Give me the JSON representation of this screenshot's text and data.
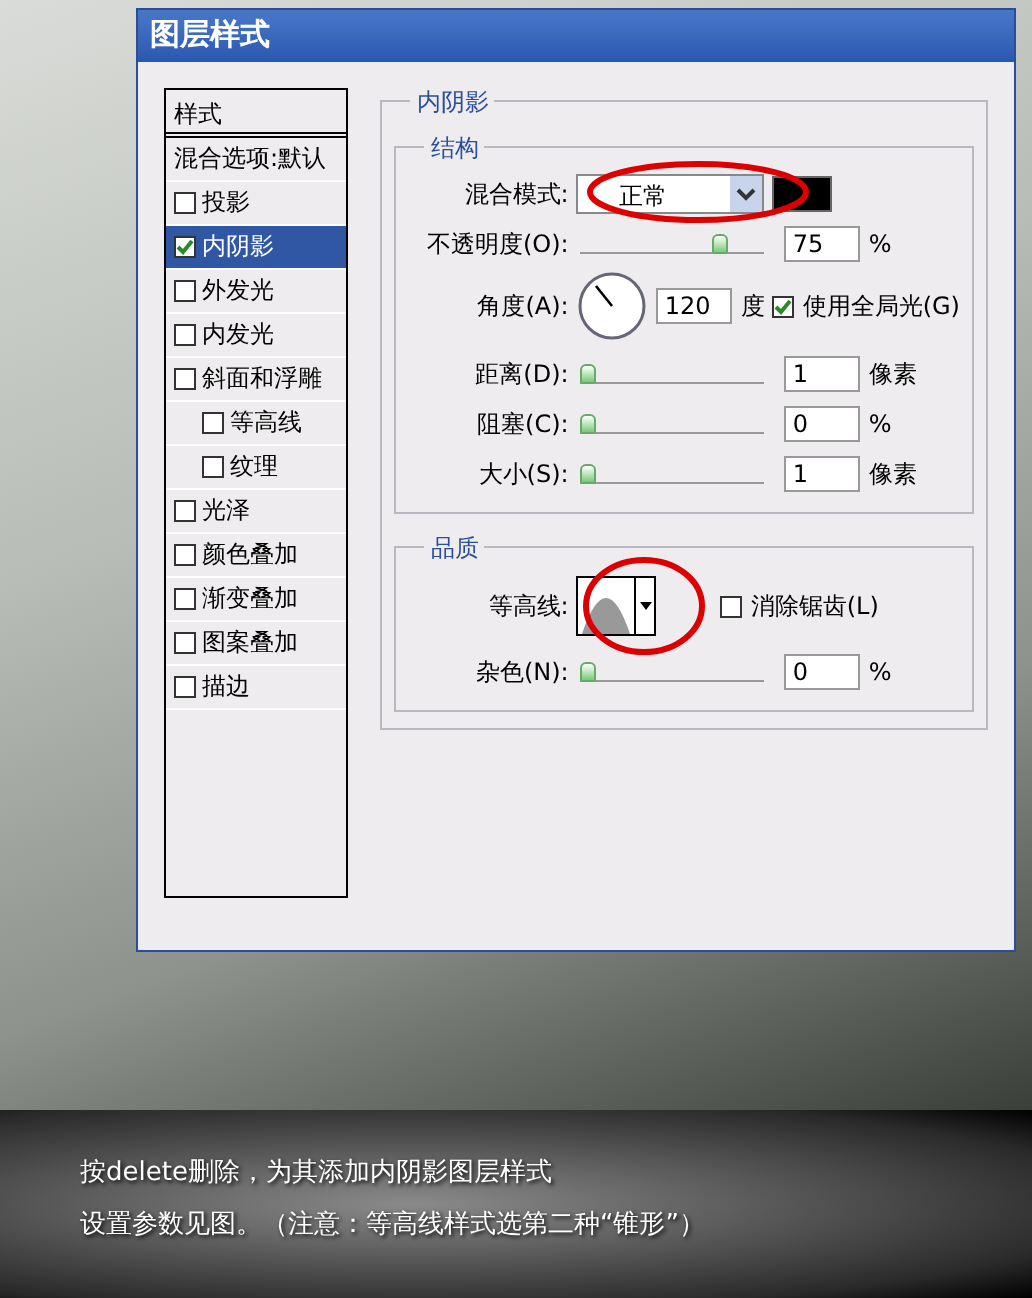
{
  "window": {
    "title": "图层样式"
  },
  "styles_list": {
    "header": "样式",
    "items": [
      {
        "label": "混合选项:默认",
        "kind": "plain",
        "selected": false
      },
      {
        "label": "投影",
        "kind": "check",
        "checked": false,
        "selected": false
      },
      {
        "label": "内阴影",
        "kind": "check",
        "checked": true,
        "selected": true
      },
      {
        "label": "外发光",
        "kind": "check",
        "checked": false,
        "selected": false
      },
      {
        "label": "内发光",
        "kind": "check",
        "checked": false,
        "selected": false
      },
      {
        "label": "斜面和浮雕",
        "kind": "check",
        "checked": false,
        "selected": false,
        "children": [
          {
            "label": "等高线",
            "kind": "check",
            "checked": false,
            "selected": false
          },
          {
            "label": "纹理",
            "kind": "check",
            "checked": false,
            "selected": false
          }
        ]
      },
      {
        "label": "光泽",
        "kind": "check",
        "checked": false,
        "selected": false
      },
      {
        "label": "颜色叠加",
        "kind": "check",
        "checked": false,
        "selected": false
      },
      {
        "label": "渐变叠加",
        "kind": "check",
        "checked": false,
        "selected": false
      },
      {
        "label": "图案叠加",
        "kind": "check",
        "checked": false,
        "selected": false
      },
      {
        "label": "描边",
        "kind": "check",
        "checked": false,
        "selected": false
      }
    ]
  },
  "panel": {
    "title": "内阴影",
    "structure": {
      "title": "结构",
      "rows": [
        {
          "kind": "blend",
          "label": "混合模式:",
          "value": "正常"
        },
        {
          "kind": "slider",
          "label": "不透明度(O):",
          "level": 0.78,
          "value": "75",
          "unit": "%"
        },
        {
          "kind": "angle",
          "label": "角度(A):",
          "value": "120",
          "unit": "度",
          "checkbox": {
            "label": "使用全局光(G)",
            "checked": true
          }
        },
        {
          "kind": "slider",
          "label": "距离(D):",
          "level": 0,
          "value": "1",
          "unit": "像素"
        },
        {
          "kind": "slider",
          "label": "阻塞(C):",
          "level": 0,
          "value": "0",
          "unit": "%"
        },
        {
          "kind": "slider",
          "label": "大小(S):",
          "level": 0,
          "value": "1",
          "unit": "像素"
        }
      ]
    },
    "quality": {
      "title": "品质",
      "rows": [
        {
          "kind": "contour",
          "label": "等高线:",
          "checkbox": {
            "label": "消除锯齿(L)",
            "checked": false
          }
        },
        {
          "kind": "slider",
          "label": "杂色(N):",
          "level": 0,
          "value": "0",
          "unit": "%"
        }
      ]
    }
  },
  "caption": [
    "按delete删除，为其添加内阴影图层样式",
    "设置参数见图。（注意：等高线样式选第二种“锥形”）"
  ]
}
